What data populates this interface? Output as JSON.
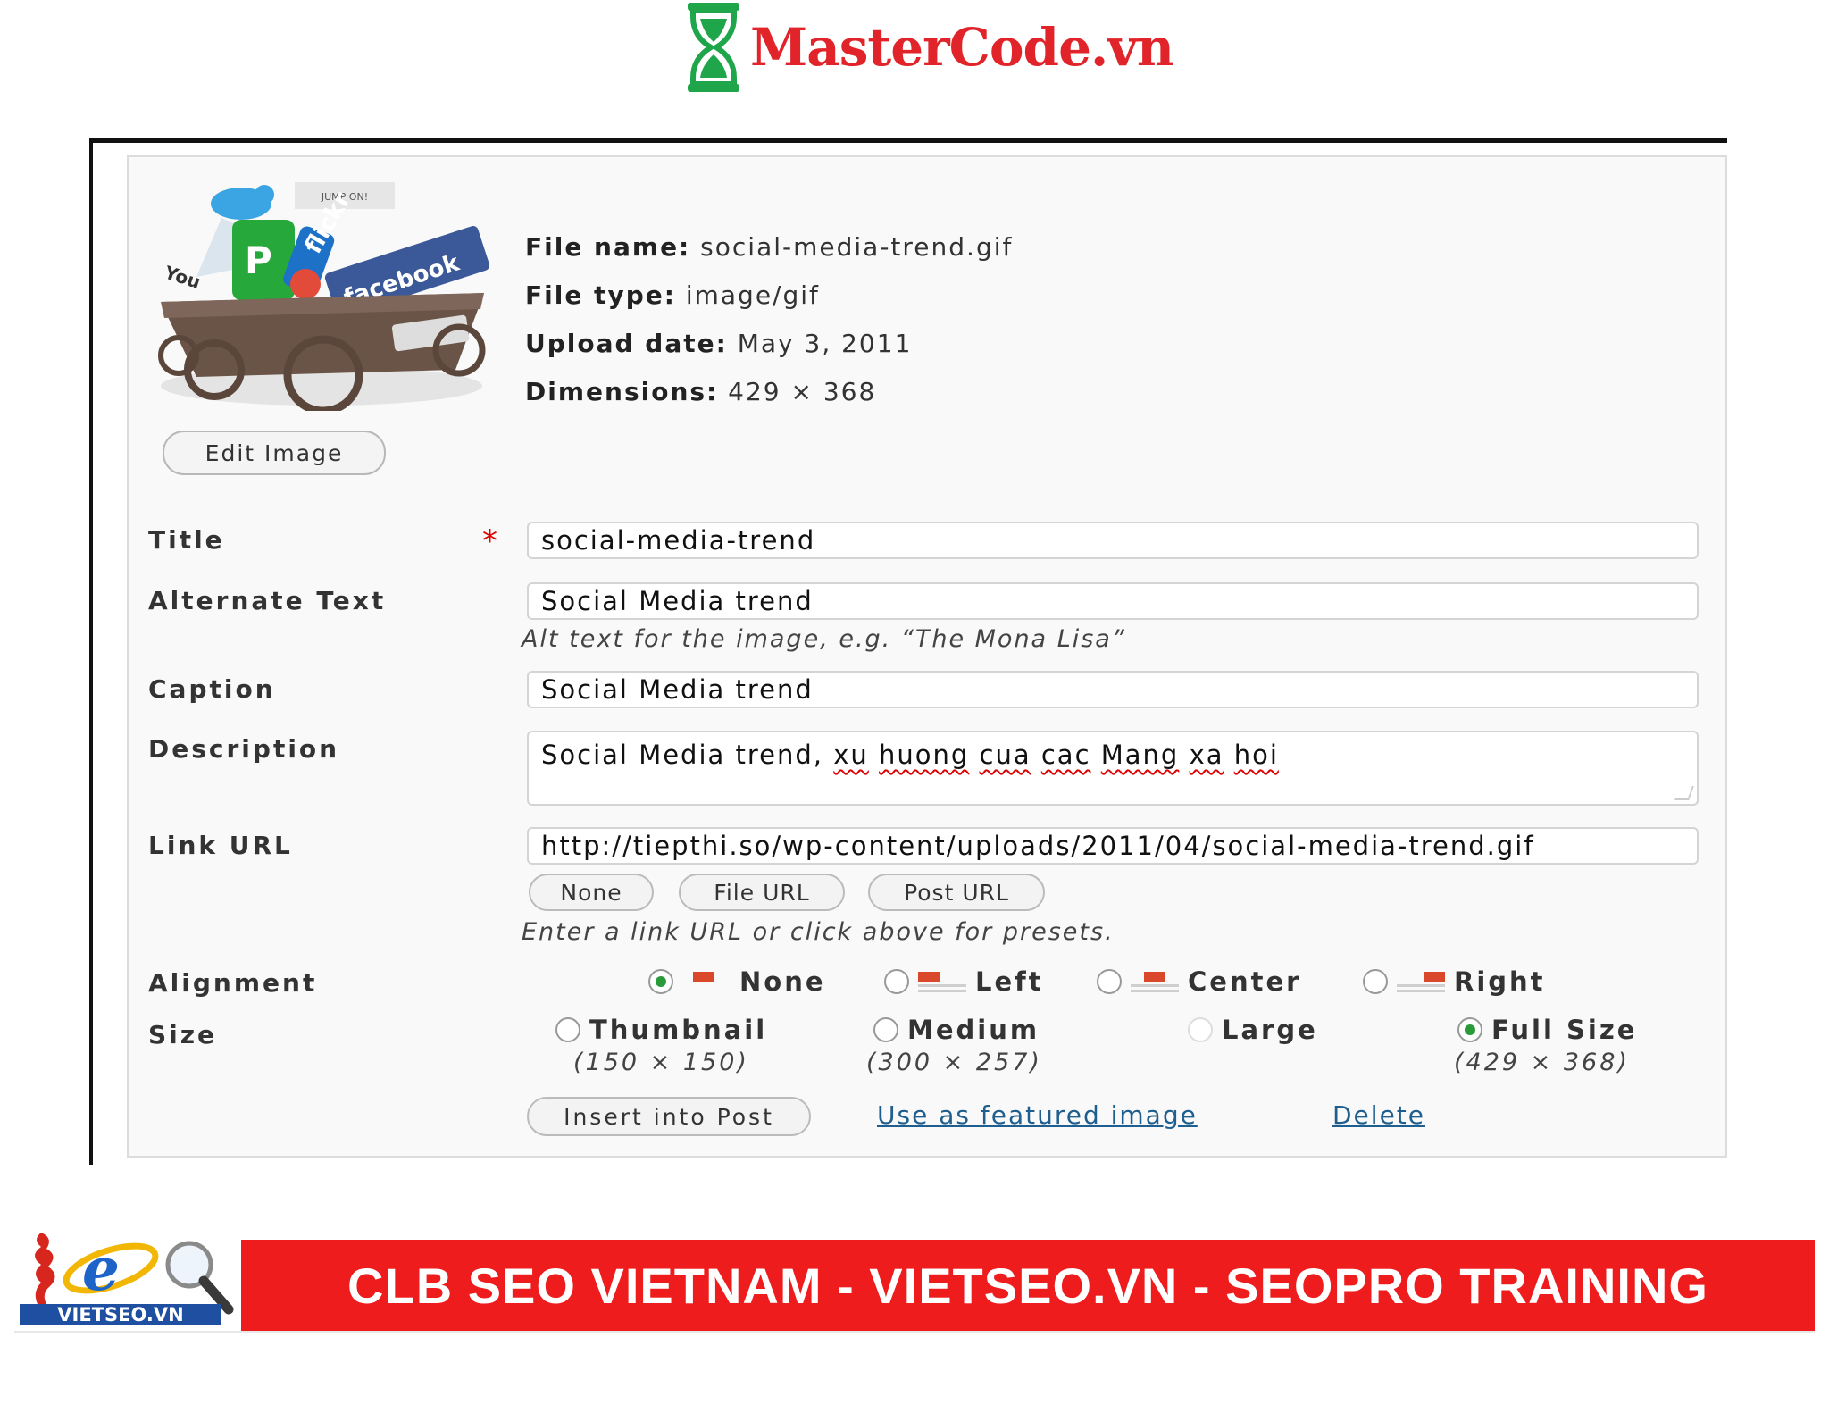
{
  "header": {
    "brand": "MasterCode.vn"
  },
  "attachment": {
    "file_name_label": "File name:",
    "file_name": "social-media-trend.gif",
    "file_type_label": "File type:",
    "file_type": "image/gif",
    "upload_date_label": "Upload date:",
    "upload_date": "May 3, 2011",
    "dimensions_label": "Dimensions:",
    "dimensions": "429 × 368",
    "edit_image_label": "Edit Image",
    "thumb_texts": {
      "jump": "JUMP ON!",
      "facebook": "facebook",
      "flickr": "flickr",
      "youtube": "You"
    }
  },
  "form": {
    "title_label": "Title",
    "required_mark": "*",
    "title_value": "social-media-trend",
    "alt_label": "Alternate Text",
    "alt_value": "Social Media trend",
    "alt_hint": "Alt text for the image, e.g. “The Mona Lisa”",
    "caption_label": "Caption",
    "caption_value": "Social Media trend",
    "description_label": "Description",
    "description_prefix": "Social Media trend, ",
    "description_misspelled": [
      "xu",
      "huong",
      "cua",
      "cac",
      "Mang",
      "xa",
      "hoi"
    ],
    "link_label": "Link URL",
    "link_value": "http://tiepthi.so/wp-content/uploads/2011/04/social-media-trend.gif",
    "link_buttons": [
      "None",
      "File URL",
      "Post URL"
    ],
    "link_hint": "Enter a link URL or click above for presets.",
    "alignment_label": "Alignment",
    "alignment_options": [
      "None",
      "Left",
      "Center",
      "Right"
    ],
    "alignment_selected": "None",
    "size_label": "Size",
    "size_options": [
      {
        "label": "Thumbnail",
        "dims": "(150 × 150)"
      },
      {
        "label": "Medium",
        "dims": "(300 × 257)"
      },
      {
        "label": "Large",
        "dims": ""
      },
      {
        "label": "Full Size",
        "dims": "(429 × 368)"
      }
    ],
    "size_selected": "Full Size",
    "insert_label": "Insert into Post",
    "featured_label": "Use as featured image",
    "delete_label": "Delete"
  },
  "footer": {
    "logo_text": "VIETSEO.VN",
    "banner_text": "CLB SEO VIETNAM - VIETSEO.VN - SEOPRO TRAINING"
  },
  "colors": {
    "brand_red": "#e0242a",
    "hourglass_green": "#1fa64a",
    "banner_red": "#ee1c1c",
    "radio_green": "#2a9a3a",
    "link_blue": "#1f5f8f"
  }
}
